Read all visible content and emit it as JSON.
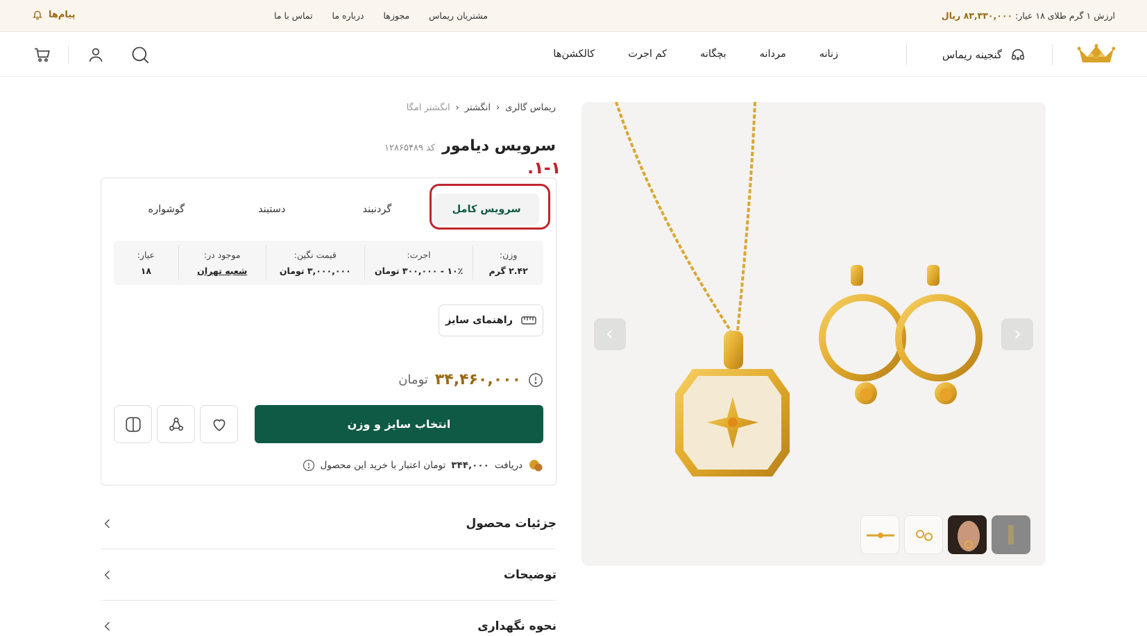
{
  "topbar": {
    "gold_price_prefix": "ارزش ۱ گرم طلای ۱۸ عیار:",
    "gold_price_value": "۸۳,۳۳۰,۰۰۰ ریال",
    "links": [
      "مشتریان ریماس",
      "مجوزها",
      "درباره ما",
      "تماس با ما"
    ],
    "messages_label": "پیام‌ها"
  },
  "nav": {
    "treasury_label": "گنجینه ریماس",
    "links": [
      "زنانه",
      "مردانه",
      "بچگانه",
      "کم اجرت",
      "کالکشن‌ها"
    ],
    "icons": [
      "search-icon",
      "user-icon",
      "cart-icon"
    ]
  },
  "breadcrumb": [
    "ریماس گالری",
    "انگشتر",
    "انگشتر امگا"
  ],
  "product": {
    "title": "سرویس دیامور",
    "code": "کد ۱۲۸۶۵۴۸۹",
    "annotation": "۱-۱.",
    "tabs": [
      "سرویس کامل",
      "گردنبند",
      "دستبند",
      "گوشواره"
    ],
    "active_tab": "سرویس کامل",
    "specs": [
      {
        "label": "وزن:",
        "value": "۲.۴۲ گرم"
      },
      {
        "label": "اجرت:",
        "value": "۱۰٪ - ۳۰۰,۰۰۰ تومان"
      },
      {
        "label": "قیمت نگین:",
        "value": "۳,۰۰۰,۰۰۰ تومان"
      },
      {
        "label": "موجود در:",
        "value": "شعبه تهران"
      },
      {
        "label": "عیار:",
        "value": "۱۸"
      }
    ],
    "size_guide": "راهنمای سایز",
    "price": "۳۴,۴۶۰,۰۰۰",
    "currency": "تومان",
    "buy_button": "انتخاب سایز و وزن",
    "credit_prefix": "دریافت",
    "credit_amount": "۳۴۴,۰۰۰",
    "credit_suffix": "تومان اعتبار با خرید این محصول"
  },
  "accordion": [
    "جزئیات محصول",
    "توضیحات",
    "نحوه نگهداری"
  ],
  "colors": {
    "brand_green": "#0f5a44",
    "gold": "#9a6a14",
    "annotation_red": "#c0242b",
    "topbar_bg": "#faf6ee"
  }
}
